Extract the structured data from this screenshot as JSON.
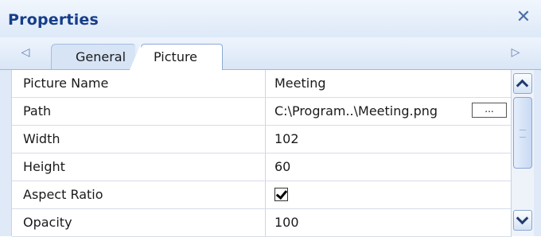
{
  "panel": {
    "title": "Properties",
    "close_glyph": "✕"
  },
  "tabs": [
    {
      "label": "General",
      "active": false
    },
    {
      "label": "Picture",
      "active": true
    }
  ],
  "nav": {
    "left_glyph": "◁",
    "right_glyph": "▷"
  },
  "properties": [
    {
      "name": "Picture Name",
      "value": "Meeting"
    },
    {
      "name": "Path",
      "value": "C:\\Program..\\Meeting.png",
      "button_label": "..."
    },
    {
      "name": "Width",
      "value": "102"
    },
    {
      "name": "Height",
      "value": "60"
    },
    {
      "name": "Aspect Ratio",
      "checked": true
    },
    {
      "name": "Opacity",
      "value": "100"
    }
  ],
  "colors": {
    "title": "#153d8a",
    "active_tab": "#ffffff",
    "header_bg": "#dde9f8"
  },
  "icons": {
    "close": "close-icon",
    "scroll_left": "triangle-left-icon",
    "scroll_right": "triangle-right-icon",
    "scroll_up": "chevron-up-icon",
    "scroll_down": "chevron-down-icon",
    "check": "checkmark-icon"
  }
}
